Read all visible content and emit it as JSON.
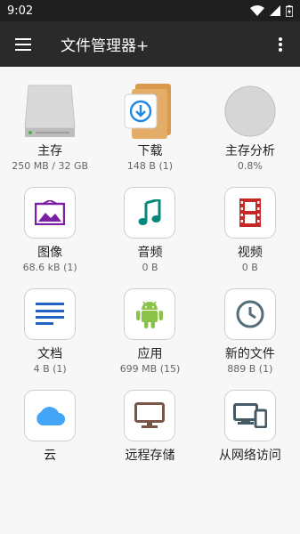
{
  "status": {
    "time": "9:02"
  },
  "appbar": {
    "title": "文件管理器+",
    "menu_icon": "hamburger-icon",
    "more_icon": "overflow-icon"
  },
  "tiles": [
    {
      "label": "主存",
      "sub": "250 MB / 32 GB",
      "icon": "storage-drive-icon"
    },
    {
      "label": "下载",
      "sub": "148 B (1)",
      "icon": "download-folder-icon"
    },
    {
      "label": "主存分析",
      "sub": "0.8%",
      "icon": "pie-analysis-icon"
    },
    {
      "label": "图像",
      "sub": "68.6 kB (1)",
      "icon": "image-icon",
      "color": "#7b1fa2"
    },
    {
      "label": "音频",
      "sub": "0 B",
      "icon": "music-icon",
      "color": "#00897b"
    },
    {
      "label": "视频",
      "sub": "0 B",
      "icon": "film-icon",
      "color": "#c62828"
    },
    {
      "label": "文档",
      "sub": "4 B (1)",
      "icon": "document-icon",
      "color": "#1e63c6"
    },
    {
      "label": "应用",
      "sub": "699 MB (15)",
      "icon": "android-icon",
      "color": "#8bc34a"
    },
    {
      "label": "新的文件",
      "sub": "889 B (1)",
      "icon": "clock-icon",
      "color": "#546e7a"
    },
    {
      "label": "云",
      "sub": "",
      "icon": "cloud-icon",
      "color": "#42a5f5"
    },
    {
      "label": "远程存储",
      "sub": "",
      "icon": "monitor-icon",
      "color": "#795548"
    },
    {
      "label": "从网络访问",
      "sub": "",
      "icon": "devices-icon",
      "color": "#455a64"
    }
  ]
}
